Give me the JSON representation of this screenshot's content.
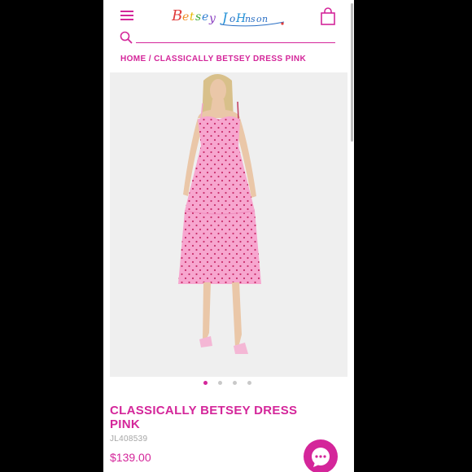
{
  "colors": {
    "brand": "#d4269a",
    "dress": "#f7a6cf",
    "image_bg": "#efefef",
    "muted_text": "#a5a5a5"
  },
  "header": {
    "logo_text": "Betsey Johnson",
    "menu_icon": "hamburger-menu-icon",
    "bag_icon": "shopping-bag-icon",
    "search_icon": "search-icon",
    "search_placeholder": ""
  },
  "breadcrumb": {
    "home": "HOME",
    "separator": " / ",
    "current": "CLASSICALLY BETSEY DRESS PINK"
  },
  "gallery": {
    "image_alt": "Model wearing pink polka-dot tulle midi dress",
    "slide_count": 4,
    "active_slide": 1
  },
  "product": {
    "title": "CLASSICALLY BETSEY DRESS PINK",
    "sku": "JL408539",
    "price": "$139.00"
  },
  "chat": {
    "icon": "chat-bubble-icon"
  }
}
